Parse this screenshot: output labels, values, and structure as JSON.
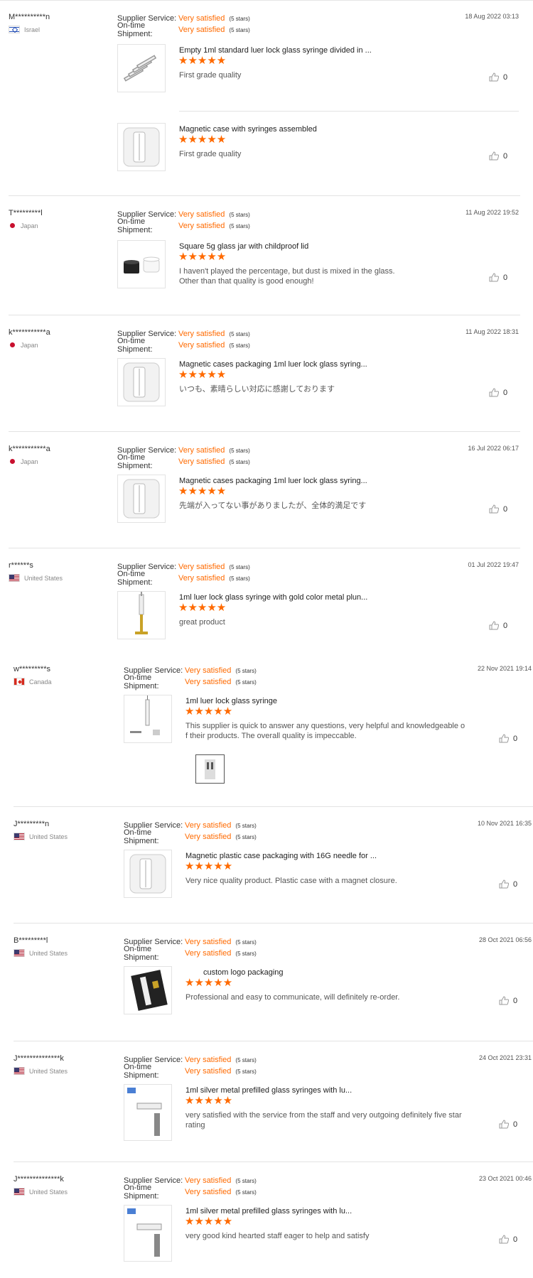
{
  "labels": {
    "supplier_service": "Supplier Service:",
    "on_time_shipment": "On-time Shipment:"
  },
  "colors": {
    "accent": "#ff6a00"
  },
  "reviews": [
    {
      "buyer": "M**********n",
      "country": "Israel",
      "flag_icon": "israel-flag-icon",
      "supplier_service": "Very satisfied",
      "supplier_stars": "(5 stars)",
      "shipment": "Very satisfied",
      "shipment_stars": "(5 stars)",
      "date": "18 Aug 2022 03:13",
      "products": [
        {
          "title": "Empty 1ml standard luer lock glass syringe divided in ...",
          "stars": "★★★★★",
          "rating": 5,
          "comment": "First grade quality",
          "helpful": "0"
        },
        {
          "title": "Magnetic case with syringes assembled",
          "stars": "★★★★★",
          "rating": 5,
          "comment": "First grade quality",
          "helpful": "0"
        }
      ]
    },
    {
      "buyer": "T*********l",
      "country": "Japan",
      "flag_icon": "japan-flag-icon",
      "supplier_service": "Very satisfied",
      "supplier_stars": "(5 stars)",
      "shipment": "Very satisfied",
      "shipment_stars": "(5 stars)",
      "date": "11 Aug 2022 19:52",
      "products": [
        {
          "title": "Square 5g glass jar with childproof lid",
          "stars": "★★★★★",
          "rating": 5,
          "comment_lines": [
            "I haven't played the percentage, but dust is mixed in the glass.",
            "Other than that quality is good enough!"
          ],
          "helpful": "0"
        }
      ]
    },
    {
      "buyer": "k***********a",
      "country": "Japan",
      "flag_icon": "japan-flag-icon",
      "supplier_service": "Very satisfied",
      "supplier_stars": "(5 stars)",
      "shipment": "Very satisfied",
      "shipment_stars": "(5 stars)",
      "date": "11 Aug 2022 18:31",
      "products": [
        {
          "title": "Magnetic cases packaging 1ml luer lock glass syring...",
          "stars": "★★★★★",
          "rating": 5,
          "comment": "いつも、素晴らしい対応に感謝しております",
          "helpful": "0"
        }
      ]
    },
    {
      "buyer": "k***********a",
      "country": "Japan",
      "flag_icon": "japan-flag-icon",
      "supplier_service": "Very satisfied",
      "supplier_stars": "(5 stars)",
      "shipment": "Very satisfied",
      "shipment_stars": "(5 stars)",
      "date": "16 Jul 2022 06:17",
      "products": [
        {
          "title": "Magnetic cases packaging 1ml luer lock glass syring...",
          "stars": "★★★★★",
          "rating": 5,
          "comment": "先端が入ってない事がありましたが、全体的満足です",
          "helpful": "0"
        }
      ]
    },
    {
      "buyer": "r******s",
      "country": "United States",
      "flag_icon": "us-flag-icon",
      "supplier_service": "Very satisfied",
      "supplier_stars": "(5 stars)",
      "shipment": "Very satisfied",
      "shipment_stars": "(5 stars)",
      "date": "01 Jul 2022 19:47",
      "products": [
        {
          "title": "1ml luer lock glass syringe with gold color metal plun...",
          "stars": "★★★★★",
          "rating": 5,
          "comment": "great product",
          "helpful": "0"
        }
      ]
    },
    {
      "buyer": "w*********s",
      "country": "Canada",
      "flag_icon": "canada-flag-icon",
      "supplier_service": "Very satisfied",
      "supplier_stars": "(5 stars)",
      "shipment": "Very satisfied",
      "shipment_stars": "(5 stars)",
      "date": "22 Nov 2021 19:14",
      "products": [
        {
          "title": "1ml luer lock glass syringe",
          "stars": "★★★★★",
          "rating": 5,
          "comment_lines": [
            "This supplier is quick to answer any questions,  very helpful and knowledgeable o",
            "f their products. The overall quality is impeccable."
          ],
          "helpful": "0"
        }
      ]
    },
    {
      "buyer": "J*********n",
      "country": "United States",
      "flag_icon": "us-flag-icon",
      "supplier_service": "Very satisfied",
      "supplier_stars": "(5 stars)",
      "shipment": "Very satisfied",
      "shipment_stars": "(5 stars)",
      "date": "10 Nov 2021 16:35",
      "products": [
        {
          "title": "Magnetic plastic case packaging with 16G needle for ...",
          "stars": "★★★★★",
          "rating": 5,
          "comment": "Very nice quality product. Plastic case with a magnet closure.",
          "helpful": "0"
        }
      ]
    },
    {
      "buyer": "B*********l",
      "country": "United States",
      "flag_icon": "us-flag-icon",
      "supplier_service": "Very satisfied",
      "supplier_stars": "(5 stars)",
      "shipment": "Very satisfied",
      "shipment_stars": "(5 stars)",
      "date": "28 Oct 2021 06:56",
      "products": [
        {
          "title": "custom logo packaging",
          "stars": "★★★★★",
          "rating": 5,
          "comment": "Professional and easy to communicate, will definitely re-order.",
          "helpful": "0"
        }
      ]
    },
    {
      "buyer": "J**************k",
      "country": "United States",
      "flag_icon": "us-flag-icon",
      "supplier_service": "Very satisfied",
      "supplier_stars": "(5 stars)",
      "shipment": "Very satisfied",
      "shipment_stars": "(5 stars)",
      "date": "24 Oct 2021 23:31",
      "products": [
        {
          "title": "1ml silver metal            prefilled glass syringes with lu...",
          "stars": "★★★★★",
          "rating": 5,
          "comment_lines": [
            "very satisfied with the service from the staff and very outgoing definitely five star",
            "rating"
          ],
          "helpful": "0"
        }
      ]
    },
    {
      "buyer": "J**************k",
      "country": "United States",
      "flag_icon": "us-flag-icon",
      "supplier_service": "Very satisfied",
      "supplier_stars": "(5 stars)",
      "shipment": "Very satisfied",
      "shipment_stars": "(5 stars)",
      "date": "23 Oct 2021 00:46",
      "products": [
        {
          "title": "1ml silver metal            prefilled glass syringes with lu...",
          "stars": "★★★★★",
          "rating": 5,
          "comment": "very good kind hearted staff eager to help and satisfy",
          "helpful": "0"
        }
      ]
    }
  ]
}
